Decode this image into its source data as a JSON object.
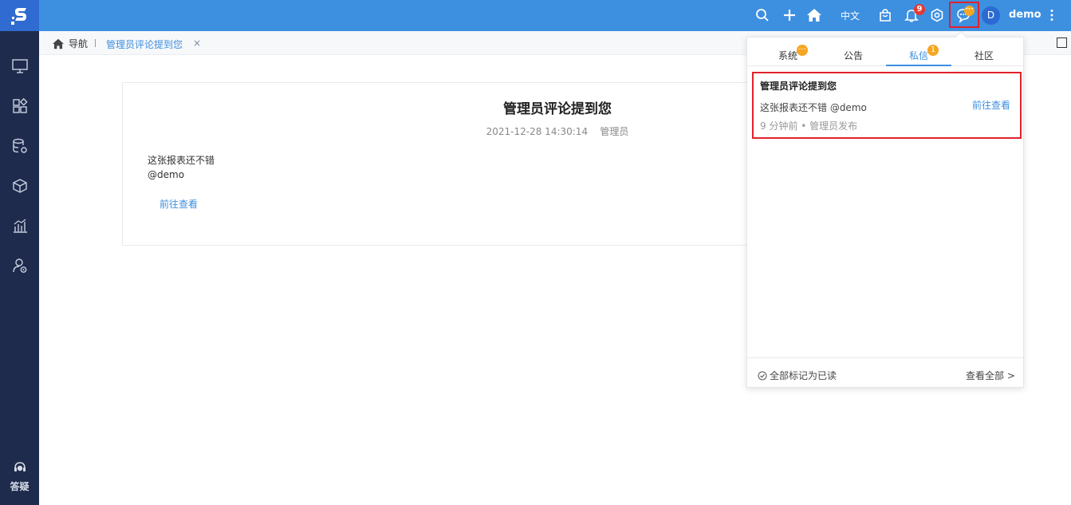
{
  "sidebar": {
    "items": [
      {
        "icon": "monitor-icon"
      },
      {
        "icon": "apps-grid-icon"
      },
      {
        "icon": "database-settings-icon"
      },
      {
        "icon": "cube-icon"
      },
      {
        "icon": "bar-chart-icon"
      },
      {
        "icon": "user-settings-icon"
      }
    ],
    "help_label": "答疑"
  },
  "topbar": {
    "lang_label": "中文",
    "notification_count": "9",
    "message_badge": "···",
    "avatar_letter": "D",
    "user_name": "demo"
  },
  "breadcrumb": {
    "home_label": "导航",
    "tab_label": "管理员评论提到您",
    "close_symbol": "×"
  },
  "article": {
    "title": "管理员评论提到您",
    "datetime": "2021-12-28 14:30:14",
    "author": "管理员",
    "body_line1": "这张报表还不错",
    "body_line2": "@demo",
    "link_label": "前往查看"
  },
  "popover": {
    "tabs": [
      {
        "label": "系统",
        "badge": "···"
      },
      {
        "label": "公告",
        "badge": ""
      },
      {
        "label": "私信",
        "badge": "1"
      },
      {
        "label": "社区",
        "badge": ""
      }
    ],
    "active_tab": "私信",
    "message": {
      "title": "管理员评论提到您",
      "text": "这张报表还不错 @demo",
      "link_label": "前往查看",
      "time": "9 分钟前 • 管理员发布"
    },
    "mark_all_read": "全部标记为已读",
    "view_all": "查看全部 >"
  },
  "colors": {
    "topbar": "#3d8fe0",
    "sidebar": "#1f2b4d",
    "link": "#3d8fe0",
    "highlight": "#e0222a",
    "badge_orange": "#f5a623",
    "badge_red": "#e53935"
  }
}
